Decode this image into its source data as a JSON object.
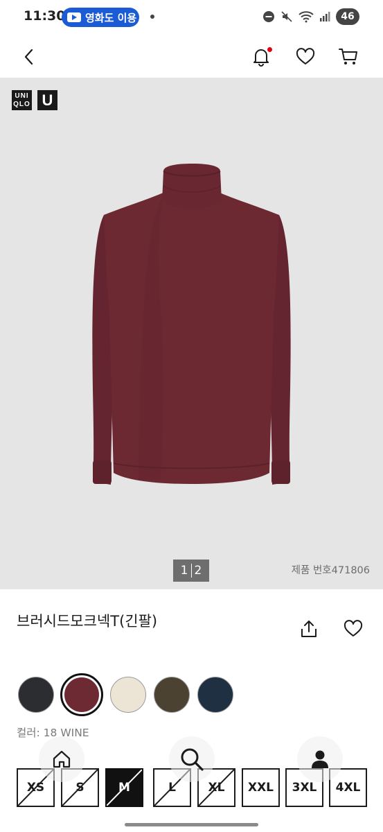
{
  "status_bar": {
    "time": "11:30",
    "pill_label": "영화도 이용",
    "battery": "46",
    "icons": [
      "dnd-icon",
      "mute-icon",
      "wifi-icon",
      "signal-icon"
    ]
  },
  "top_nav": {
    "icons": [
      "back-arrow-icon",
      "bell-icon",
      "heart-icon",
      "cart-icon"
    ],
    "notification_dot_color": "#e60012"
  },
  "gallery": {
    "brand_logo_lines": [
      "UNI",
      "QLO"
    ],
    "brand_logo_u": "U",
    "pager_current": "1",
    "pager_total": "2",
    "product_number": "제품 번호471806",
    "background_color": "#e5e5e6",
    "product_color": "#6d2932"
  },
  "product": {
    "title": "브러시드모크넥T(긴팔)",
    "actions": [
      "share-icon",
      "heart-outline-icon"
    ]
  },
  "colors": {
    "swatches": [
      {
        "name": "dark-gray",
        "hex": "#2b2d31",
        "selected": false
      },
      {
        "name": "wine",
        "hex": "#6e2a33",
        "selected": true
      },
      {
        "name": "off-white",
        "hex": "#ece5d6",
        "selected": false
      },
      {
        "name": "olive",
        "hex": "#4b4231",
        "selected": false
      },
      {
        "name": "navy",
        "hex": "#1f3042",
        "selected": false
      }
    ],
    "label": "컬러: 18 WINE"
  },
  "sizes": [
    {
      "label": "XS",
      "available": false,
      "selected": false
    },
    {
      "label": "S",
      "available": false,
      "selected": false
    },
    {
      "label": "M",
      "available": false,
      "selected": true
    },
    {
      "label": "L",
      "available": false,
      "selected": false
    },
    {
      "label": "XL",
      "available": false,
      "selected": false
    },
    {
      "label": "XXL",
      "available": true,
      "selected": false
    },
    {
      "label": "3XL",
      "available": true,
      "selected": false
    },
    {
      "label": "4XL",
      "available": true,
      "selected": false
    }
  ],
  "bottom_nav": {
    "icons": [
      "home-icon",
      "search-icon",
      "person-icon"
    ]
  }
}
